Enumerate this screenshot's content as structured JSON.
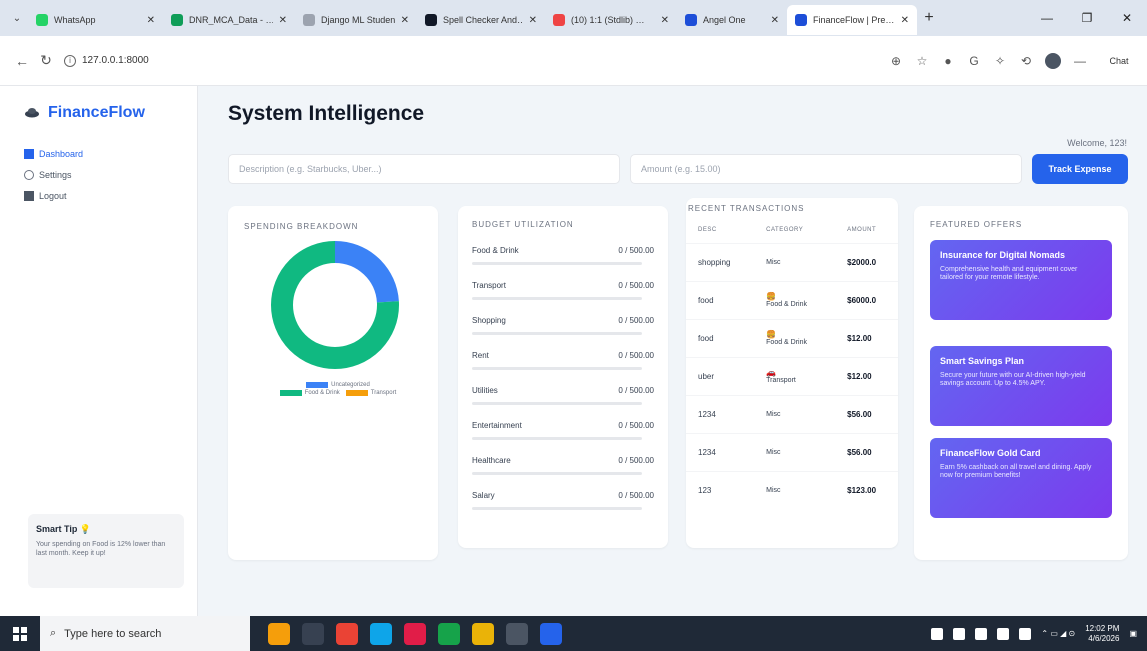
{
  "browser": {
    "tabs": [
      {
        "title": "WhatsApp",
        "color": "#25d366",
        "active": false
      },
      {
        "title": "DNR_MCA_Data - …",
        "color": "#0f9d58",
        "active": false
      },
      {
        "title": "Django ML Studen…",
        "color": "#9ca3af",
        "active": false
      },
      {
        "title": "Spell Checker And…",
        "color": "#111827",
        "active": false
      },
      {
        "title": "(10) 1:1 (Stdlib) …",
        "color": "#ef4444",
        "active": false
      },
      {
        "title": "Angel One",
        "color": "#1d4ed8",
        "active": false
      },
      {
        "title": "FinanceFlow | Pre…",
        "color": "#1d4ed8",
        "active": true
      }
    ],
    "url": "127.0.0.1:8000",
    "chat_label": "Chat"
  },
  "sidebar": {
    "brand": "FinanceFlow",
    "menu": [
      {
        "label": "Dashboard",
        "icon": "dashboard-icon",
        "active": true
      },
      {
        "label": "Settings",
        "icon": "gear-icon",
        "active": false
      },
      {
        "label": "Logout",
        "icon": "logout-icon",
        "active": false
      }
    ],
    "tip": {
      "title": "Smart Tip 💡",
      "body": "Your spending on Food is 12% lower than last month. Keep it up!"
    }
  },
  "header": {
    "title": "System Intelligence",
    "welcome": "Welcome, 123!"
  },
  "form": {
    "description_placeholder": "Description (e.g. Starbucks, Uber...)",
    "amount_placeholder": "Amount (e.g. 15.00)",
    "track_button": "Track Expense"
  },
  "spending": {
    "heading": "SPENDING BREAKDOWN",
    "chart_data": {
      "type": "pie",
      "categories": [
        "Uncategorized",
        "Food & Drink",
        "Transport"
      ],
      "values": [
        0.24,
        0.76,
        0.0
      ],
      "colors": [
        "#3b82f6",
        "#10b981",
        "#f59e0b"
      ]
    },
    "legend": [
      {
        "label": "Uncategorized",
        "color": "#3b82f6"
      },
      {
        "label": "Food & Drink",
        "color": "#10b981"
      },
      {
        "label": "Transport",
        "color": "#f59e0b"
      }
    ]
  },
  "budget": {
    "heading": "BUDGET UTILIZATION",
    "rows": [
      {
        "label": "Food & Drink",
        "value": "0 / 500.00"
      },
      {
        "label": "Transport",
        "value": "0 / 500.00"
      },
      {
        "label": "Shopping",
        "value": "0 / 500.00"
      },
      {
        "label": "Rent",
        "value": "0 / 500.00"
      },
      {
        "label": "Utilities",
        "value": "0 / 500.00"
      },
      {
        "label": "Entertainment",
        "value": "0 / 500.00"
      },
      {
        "label": "Healthcare",
        "value": "0 / 500.00"
      },
      {
        "label": "Salary",
        "value": "0 / 500.00"
      }
    ]
  },
  "recent": {
    "heading": "RECENT TRANSACTIONS",
    "columns": [
      "DESC",
      "CATEGORY",
      "AMOUNT"
    ],
    "rows": [
      {
        "desc": "shopping",
        "category": "Misc",
        "icon": "",
        "amount": "$2000.0"
      },
      {
        "desc": "food",
        "category": "Food & Drink",
        "icon": "🍔",
        "amount": "$6000.0"
      },
      {
        "desc": "food",
        "category": "Food & Drink",
        "icon": "🍔",
        "amount": "$12.00"
      },
      {
        "desc": "uber",
        "category": "Transport",
        "icon": "🚗",
        "amount": "$12.00"
      },
      {
        "desc": "1234",
        "category": "Misc",
        "icon": "",
        "amount": "$56.00"
      },
      {
        "desc": "1234",
        "category": "Misc",
        "icon": "",
        "amount": "$56.00"
      },
      {
        "desc": "123",
        "category": "Misc",
        "icon": "",
        "amount": "$123.00"
      }
    ]
  },
  "offers": {
    "heading": "FEATURED OFFERS",
    "items": [
      {
        "title": "Insurance for Digital Nomads",
        "body": "Comprehensive health and equipment cover tailored for your remote lifestyle."
      },
      {
        "title": "Smart Savings Plan",
        "body": "Secure your future with our AI-driven high-yield savings account. Up to 4.5% APY."
      },
      {
        "title": "FinanceFlow Gold Card",
        "body": "Earn 5% cashback on all travel and dining. Apply now for premium benefits!"
      }
    ]
  },
  "taskbar": {
    "search_placeholder": "Type here to search",
    "time": "12:02 PM",
    "date": "4/6/2026"
  }
}
